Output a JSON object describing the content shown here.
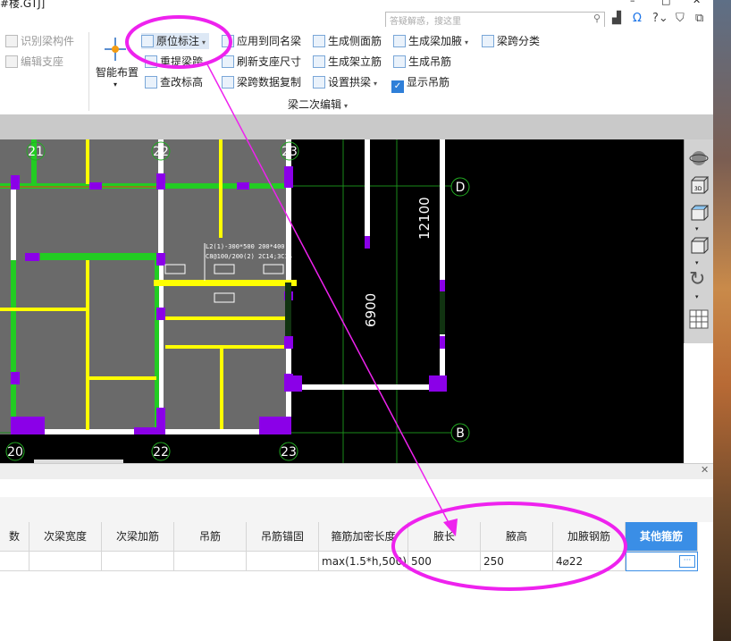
{
  "window": {
    "title": "#楼.GTJ]"
  },
  "search": {
    "placeholder": "答疑解惑，搜这里"
  },
  "toolbar_icons": [
    "chart-icon",
    "headset-icon",
    "help-icon",
    "shirt-icon",
    "restore-icon"
  ],
  "window_controls": [
    "–",
    "□",
    "✕"
  ],
  "ribbon": {
    "left_group": {
      "identify": "识别梁构件",
      "edit_support": "编辑支座"
    },
    "smart_layout": "智能布置",
    "col1": {
      "original_mark": "原位标注",
      "recalc_span": "重提梁跨",
      "edit_elevation": "查改标高"
    },
    "col2": {
      "apply_same_name": "应用到同名梁",
      "refresh_support": "刷新支座尺寸",
      "copy_span_data": "梁跨数据复制"
    },
    "col3": {
      "gen_side_rebar": "生成侧面筋",
      "gen_erection_rebar": "生成架立筋",
      "set_arch": "设置拱梁"
    },
    "col4": {
      "gen_haunch": "生成梁加腋",
      "gen_hanger": "生成吊筋",
      "show_hanger": "显示吊筋"
    },
    "col5": {
      "span_classify": "梁跨分类"
    },
    "group_label": "梁二次编辑"
  },
  "drawing": {
    "grid_labels": [
      "21",
      "22",
      "23",
      "20",
      "22",
      "23"
    ],
    "axis_labels": [
      "D",
      "B"
    ],
    "dimensions": [
      "12100",
      "6900"
    ],
    "beam_note": [
      "L2(1)-300*500 200*400",
      "C8@100/200(2) 2C14;3C14"
    ]
  },
  "table": {
    "headers": [
      "数",
      "次梁宽度",
      "次梁加筋",
      "吊筋",
      "吊筋锚固",
      "箍筋加密长度",
      "腋长",
      "腋高",
      "加腋钢筋",
      "其他箍筋"
    ],
    "row": [
      "",
      "",
      "",
      "",
      "",
      "max(1.5*h,500)",
      "500",
      "250",
      "4⌀22",
      ""
    ]
  },
  "colors": {
    "highlight_ellipse": "#ee22ee",
    "selected_header": "#3a8ee6",
    "wall_purple": "#8b00e8",
    "beam_yellow": "#ffff00",
    "beam_green": "#22cc22"
  }
}
